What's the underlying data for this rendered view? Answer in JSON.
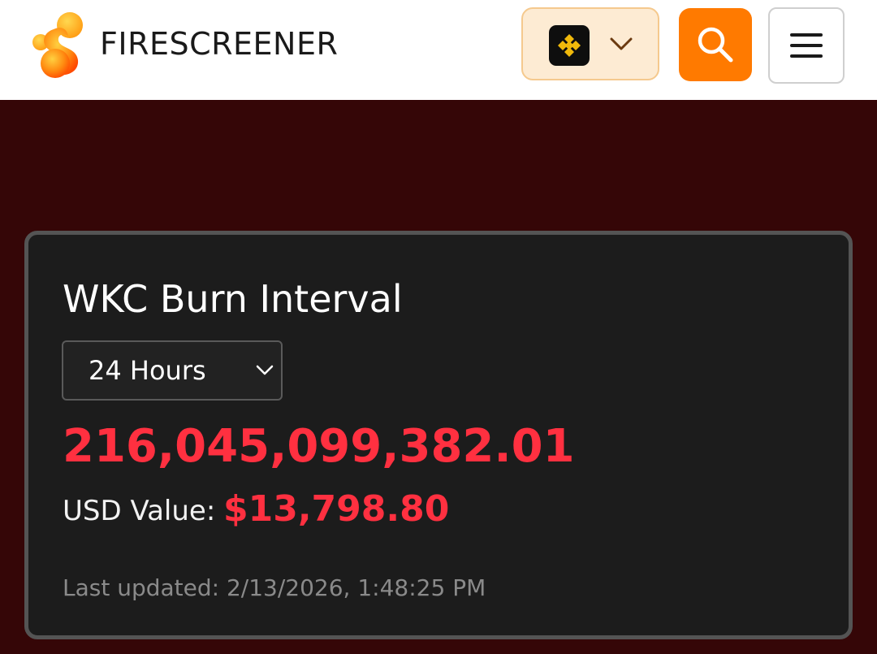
{
  "header": {
    "brand": "FIRESCREENER",
    "logo_icon": "firescreener-logo",
    "chain_selector_icon": "bnb-chain-icon",
    "colors": {
      "search_button": "#ff7a00",
      "chain_selector_bg": "#fdebd3"
    }
  },
  "card": {
    "title": "WKC Burn Interval",
    "interval_selected": "24 Hours",
    "burn_amount": "216,045,099,382.01",
    "usd_label": "USD Value:",
    "usd_value": "$13,798.80",
    "last_updated": "Last updated: 2/13/2026, 1:48:25 PM",
    "colors": {
      "amount": "#ff3040",
      "background": "#1c1c1c",
      "page_background": "#350607"
    }
  }
}
